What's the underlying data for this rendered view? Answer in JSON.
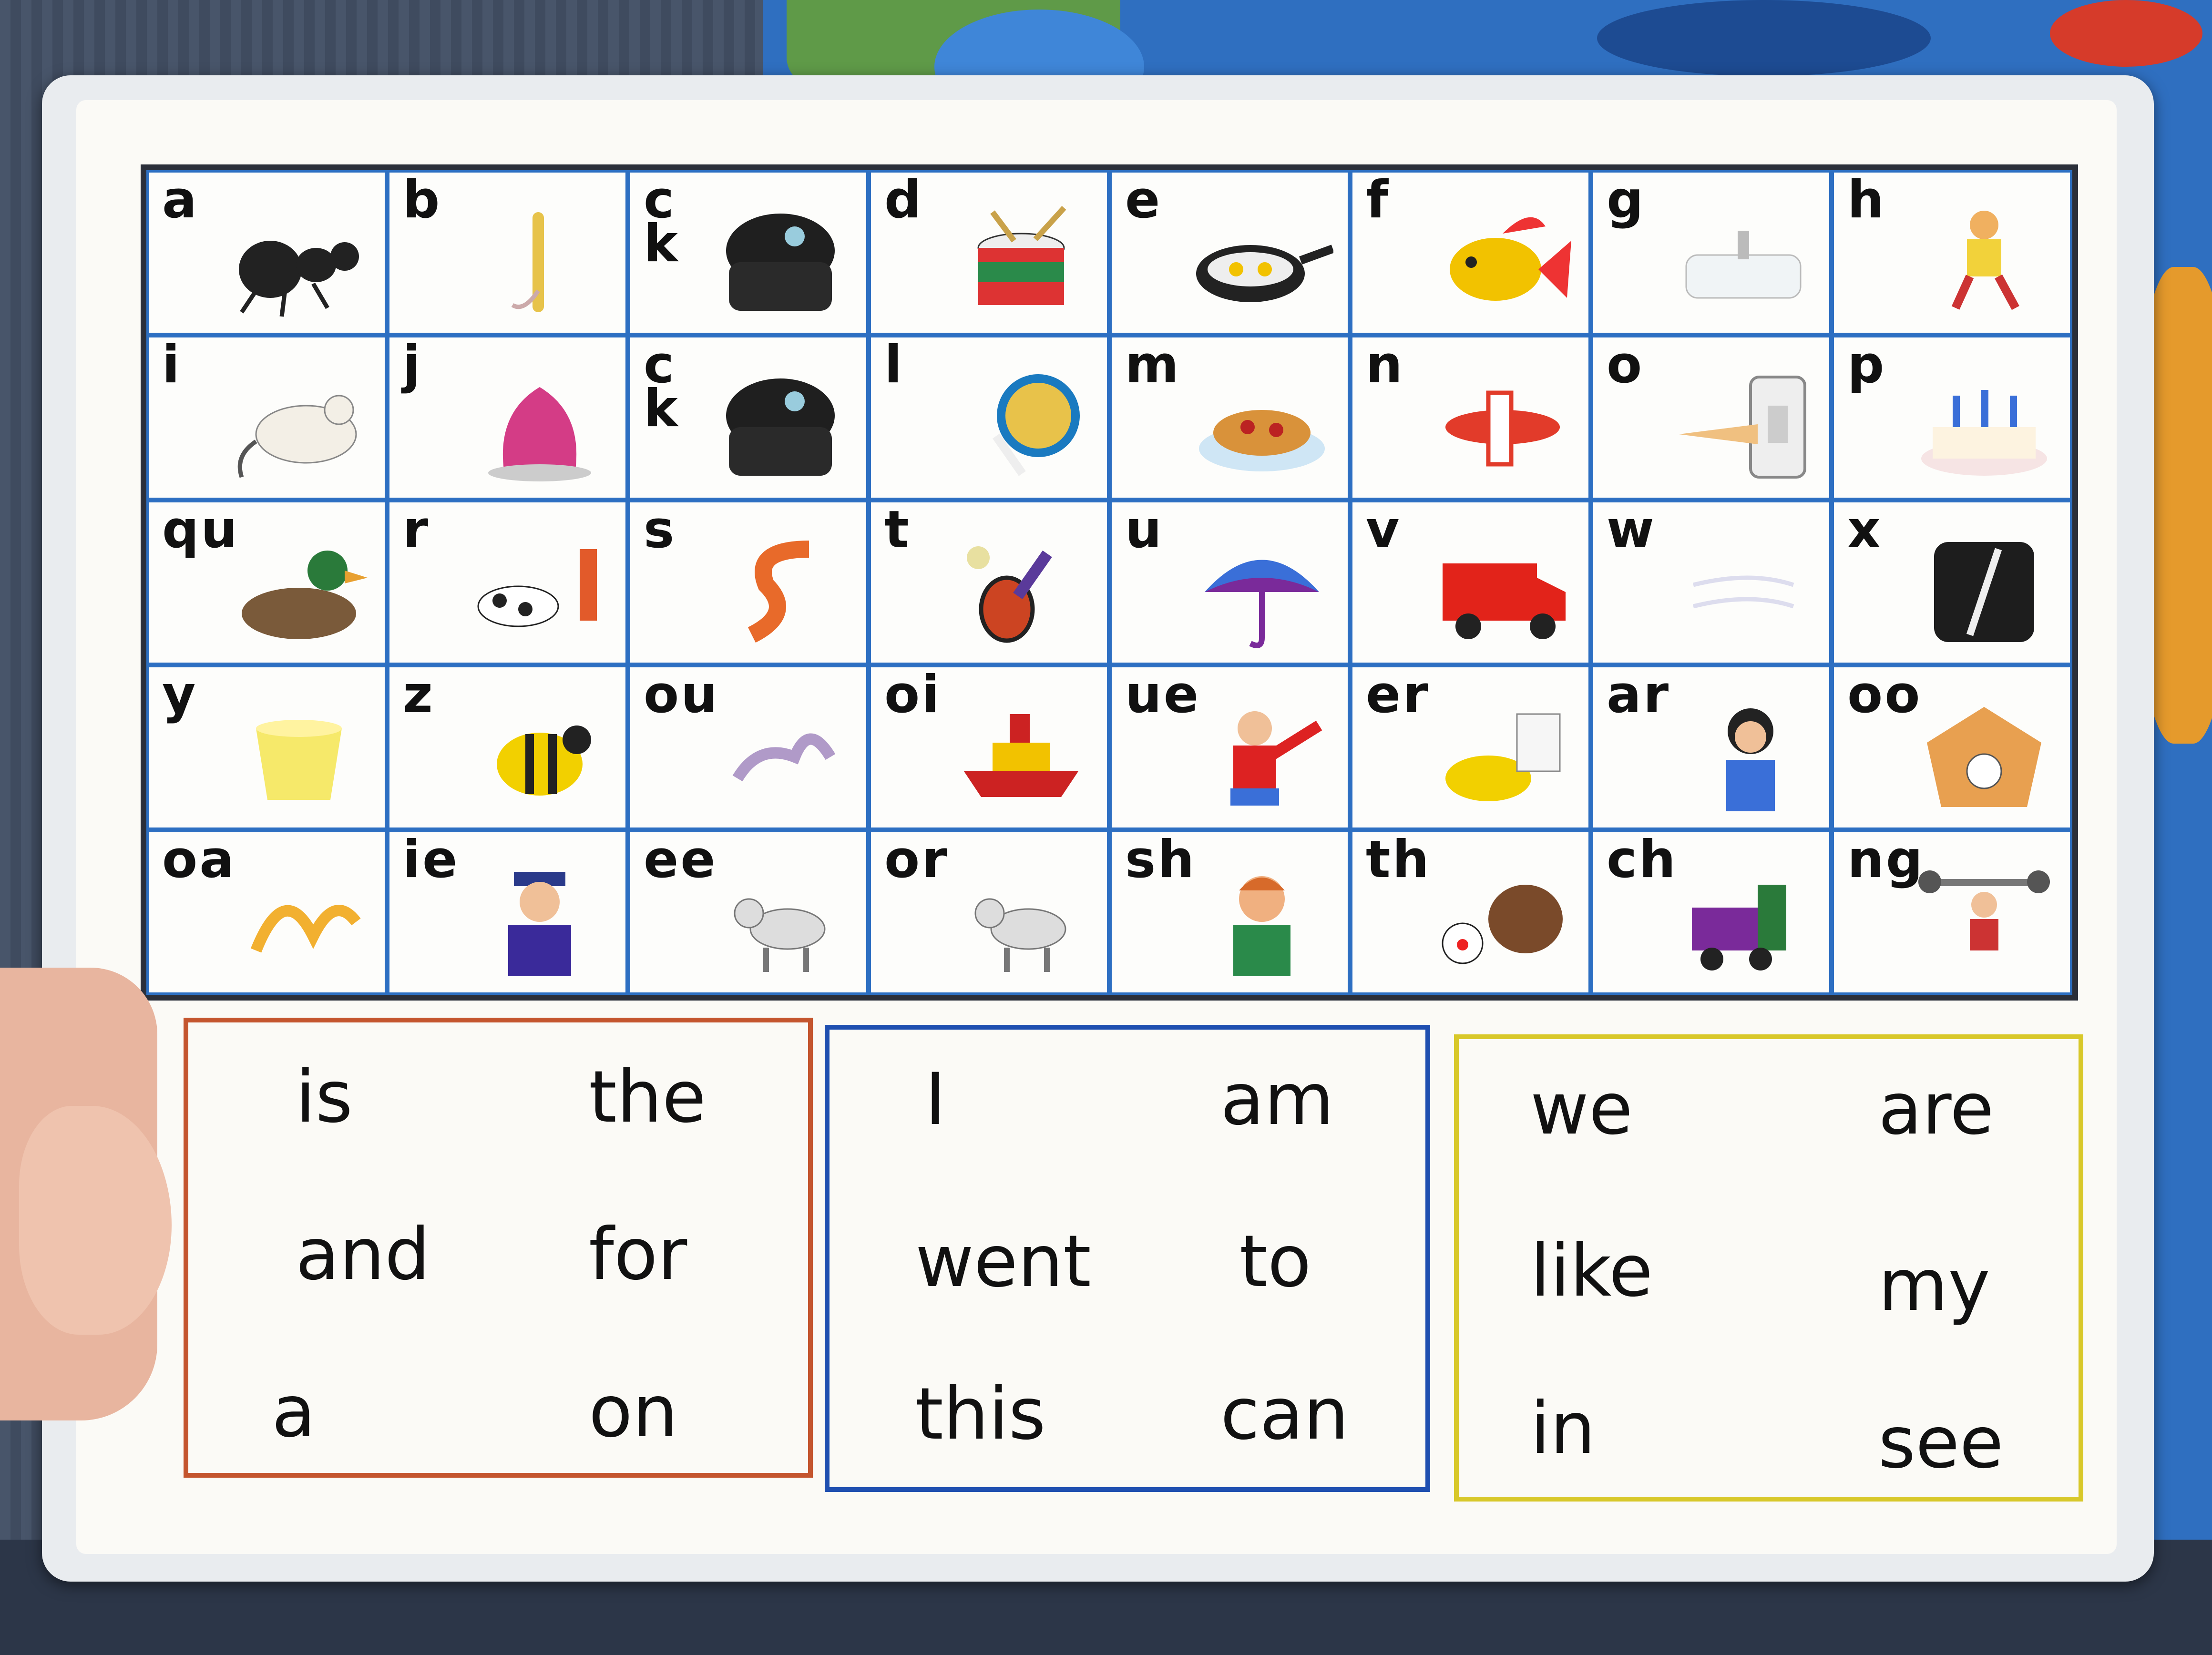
{
  "chart_card": {
    "letter_cells": [
      {
        "label": "a",
        "icon": "ant-icon"
      },
      {
        "label": "b",
        "icon": "bat-icon"
      },
      {
        "label": "c\nk",
        "icon": "camera-icon"
      },
      {
        "label": "d",
        "icon": "drum-icon"
      },
      {
        "label": "e",
        "icon": "egg-pan-icon"
      },
      {
        "label": "f",
        "icon": "fish-icon"
      },
      {
        "label": "g",
        "icon": "sink-icon"
      },
      {
        "label": "h",
        "icon": "girl-jumping-icon"
      },
      {
        "label": "i",
        "icon": "mouse-icon"
      },
      {
        "label": "j",
        "icon": "jelly-icon"
      },
      {
        "label": "c\nk",
        "icon": "camera-icon"
      },
      {
        "label": "l",
        "icon": "lollipop-icon"
      },
      {
        "label": "m",
        "icon": "spaghetti-icon"
      },
      {
        "label": "n",
        "icon": "plane-icon"
      },
      {
        "label": "o",
        "icon": "light-switch-icon"
      },
      {
        "label": "p",
        "icon": "birthday-cake-icon"
      },
      {
        "label": "qu",
        "icon": "duck-icon"
      },
      {
        "label": "r",
        "icon": "dog-tugging-icon"
      },
      {
        "label": "s",
        "icon": "snake-icon"
      },
      {
        "label": "t",
        "icon": "tennis-racket-icon"
      },
      {
        "label": "u",
        "icon": "umbrella-icon"
      },
      {
        "label": "v",
        "icon": "van-icon"
      },
      {
        "label": "w",
        "icon": "wind-icon"
      },
      {
        "label": "x",
        "icon": "x-ray-icon"
      },
      {
        "label": "y",
        "icon": "yogurt-icon"
      },
      {
        "label": "z",
        "icon": "bee-icon"
      },
      {
        "label": "ou",
        "icon": "cloud-icon"
      },
      {
        "label": "oi",
        "icon": "ship-icon"
      },
      {
        "label": "ue",
        "icon": "boy-pointing-icon"
      },
      {
        "label": "er",
        "icon": "mixer-icon"
      },
      {
        "label": "ar",
        "icon": "girl-icon"
      },
      {
        "label": "oo",
        "icon": "cuckoo-clock-icon"
      },
      {
        "label": "oa",
        "icon": "splash-icon"
      },
      {
        "label": "ie",
        "icon": "sailor-icon"
      },
      {
        "label": "ee",
        "icon": "donkey-icon"
      },
      {
        "label": "or",
        "icon": "donkey-icon"
      },
      {
        "label": "sh",
        "icon": "boy-shushing-icon"
      },
      {
        "label": "th",
        "icon": "clown-hedgehog-icon"
      },
      {
        "label": "ch",
        "icon": "train-icon"
      },
      {
        "label": "ng",
        "icon": "weightlifter-icon"
      }
    ],
    "word_boxes": [
      {
        "color": "#c4552e",
        "words": [
          "is",
          "the",
          "and",
          "for",
          "a",
          "on"
        ]
      },
      {
        "color": "#1f4fb0",
        "words": [
          "I",
          "am",
          "went",
          "to",
          "this",
          "can"
        ]
      },
      {
        "color": "#d8c82a",
        "words": [
          "we",
          "are",
          "like",
          "my",
          "in",
          "see"
        ]
      }
    ]
  }
}
